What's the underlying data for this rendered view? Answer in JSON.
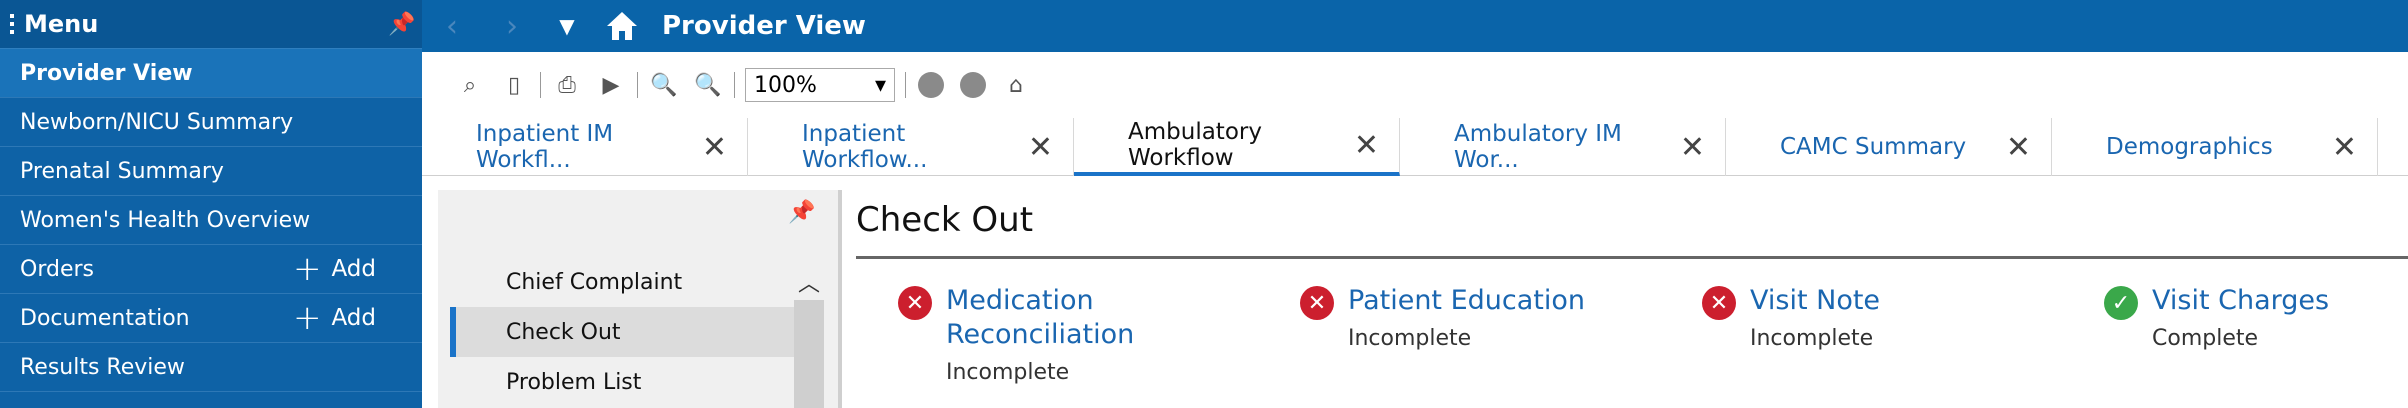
{
  "sidebar": {
    "title": "Menu",
    "items": [
      {
        "label": "Provider View",
        "active": true
      },
      {
        "label": "Newborn/NICU Summary"
      },
      {
        "label": "Prenatal Summary"
      },
      {
        "label": "Women's Health Overview"
      },
      {
        "label": "Orders",
        "action": "Add"
      },
      {
        "label": "Documentation",
        "action": "Add"
      },
      {
        "label": "Results Review"
      }
    ]
  },
  "topbar": {
    "title": "Provider View"
  },
  "toolbar": {
    "zoom": "100%"
  },
  "tabs": [
    {
      "label": "Inpatient IM Workfl..."
    },
    {
      "label": "Inpatient Workflow..."
    },
    {
      "label": "Ambulatory Workflow",
      "active": true
    },
    {
      "label": "Ambulatory IM Wor..."
    },
    {
      "label": "CAMC Summary"
    },
    {
      "label": "Demographics"
    }
  ],
  "workflow": {
    "items": [
      "Chief Complaint",
      "Check Out",
      "Problem List"
    ],
    "active": "Check Out"
  },
  "main": {
    "title": "Check Out",
    "statuses": [
      {
        "name_line1": "Medication",
        "name_line2": "Reconciliation",
        "state": "Incomplete",
        "ok": false
      },
      {
        "name_line1": "Patient Education",
        "name_line2": "",
        "state": "Incomplete",
        "ok": false
      },
      {
        "name_line1": "Visit Note",
        "name_line2": "",
        "state": "Incomplete",
        "ok": false
      },
      {
        "name_line1": "Visit Charges",
        "name_line2": "",
        "state": "Complete",
        "ok": true
      }
    ]
  },
  "colors": {
    "brand": "#0a64a9",
    "accent": "#1a73c8",
    "error": "#cc1f2e",
    "success": "#3aa84a"
  }
}
